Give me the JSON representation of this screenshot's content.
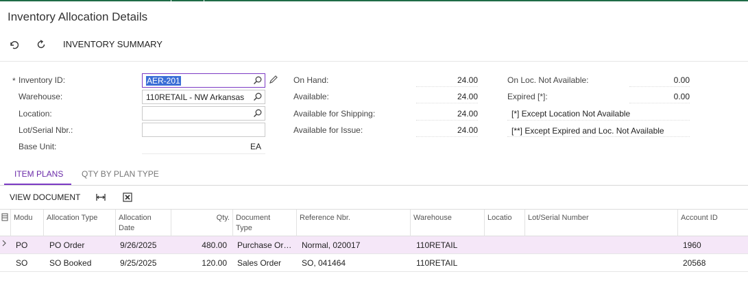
{
  "page": {
    "title": "Inventory Allocation Details"
  },
  "toolbar": {
    "undo_icon": "undo-icon",
    "refresh_icon": "refresh-icon",
    "summary_label": "INVENTORY SUMMARY"
  },
  "form": {
    "inventory_id_label": "Inventory ID:",
    "inventory_id_value": "AER-201",
    "warehouse_label": "Warehouse:",
    "warehouse_value": "110RETAIL - NW Arkansas",
    "location_label": "Location:",
    "location_value": "",
    "lot_label": "Lot/Serial Nbr.:",
    "lot_value": "",
    "base_unit_label": "Base Unit:",
    "base_unit_value": "EA",
    "required_mark": "*"
  },
  "quantities": {
    "on_hand_label": "On Hand:",
    "on_hand": "24.00",
    "available_label": "Available:",
    "available": "24.00",
    "shipping_label": "Available for Shipping:",
    "shipping": "24.00",
    "issue_label": "Available for Issue:",
    "issue": "24.00"
  },
  "right": {
    "not_available_label": "On Loc. Not Available:",
    "not_available": "0.00",
    "expired_label": "Expired [*]:",
    "expired": "0.00",
    "note1": "[*]  Except Location Not Available",
    "note2": "[**] Except Expired and  Loc. Not Available"
  },
  "tabs": [
    {
      "label": "ITEM PLANS",
      "active": true
    },
    {
      "label": "QTY BY PLAN TYPE",
      "active": false
    }
  ],
  "grid_toolbar": {
    "view_document_label": "VIEW DOCUMENT"
  },
  "grid": {
    "headers": {
      "module": "Modu",
      "alloc_type": "Allocation Type",
      "alloc_date_1": "Allocation",
      "alloc_date_2": "Date",
      "qty": "Qty.",
      "doc_type_1": "Document",
      "doc_type_2": "Type",
      "ref_nbr": "Reference Nbr.",
      "warehouse": "Warehouse",
      "location": "Locatio",
      "lot": "Lot/Serial Number",
      "account": "Account ID"
    },
    "rows": [
      {
        "module": "PO",
        "alloc_type": "PO Order",
        "alloc_date": "9/26/2025",
        "qty": "480.00",
        "doc_type": "Purchase Or…",
        "ref_nbr": "Normal, 020017",
        "warehouse": "110RETAIL",
        "location": "",
        "lot": "",
        "account": "1960"
      },
      {
        "module": "SO",
        "alloc_type": "SO Booked",
        "alloc_date": "9/25/2025",
        "qty": "120.00",
        "doc_type": "Sales Order",
        "ref_nbr": "SO, 041464",
        "warehouse": "110RETAIL",
        "location": "",
        "lot": "",
        "account": "20568"
      }
    ]
  }
}
